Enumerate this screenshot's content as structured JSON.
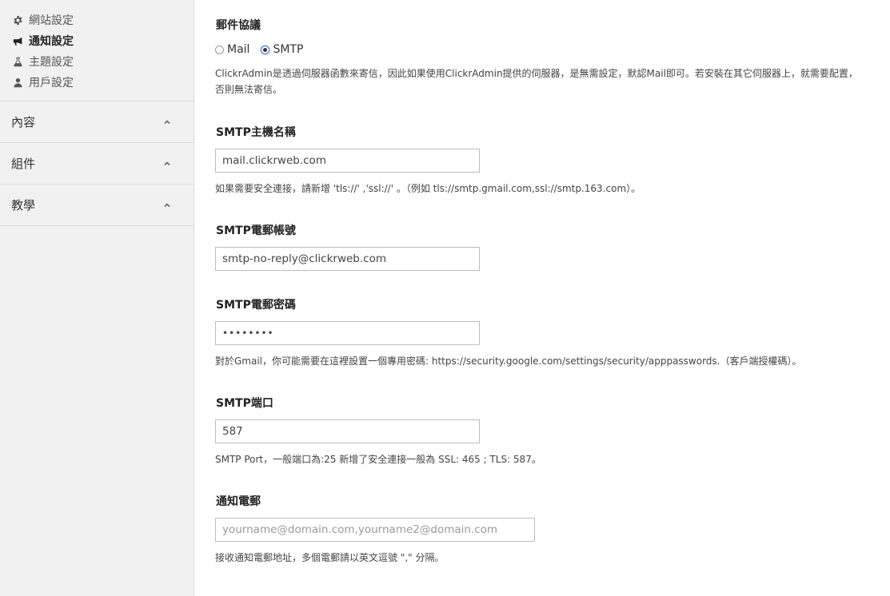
{
  "sidebar": {
    "sub_items": [
      {
        "label": "網站設定",
        "icon": "gear-icon",
        "active": false
      },
      {
        "label": "通知設定",
        "icon": "bullhorn-icon",
        "active": true
      },
      {
        "label": "主題設定",
        "icon": "flask-icon",
        "active": false
      },
      {
        "label": "用戶設定",
        "icon": "user-icon",
        "active": false
      }
    ],
    "sections": [
      {
        "label": "內容",
        "icon": "chevron-up-icon"
      },
      {
        "label": "組件",
        "icon": "chevron-up-icon"
      },
      {
        "label": "教學",
        "icon": "chevron-up-icon"
      }
    ]
  },
  "form": {
    "protocol": {
      "label": "郵件協議",
      "options": [
        "Mail",
        "SMTP"
      ],
      "selected": "SMTP",
      "help": "ClickrAdmin是透過伺服器函數來寄信，因此如果使用ClickrAdmin提供的伺服器，是無需設定，默認Mail即可。若安裝在其它伺服器上，就需要配置，否則無法寄信。"
    },
    "smtp_host": {
      "label": "SMTP主機名稱",
      "value": "mail.clickrweb.com",
      "help": "如果需要安全連接，請新增 'tls://' ,'ssl://' 。（例如 tls://smtp.gmail.com,ssl://smtp.163.com）。"
    },
    "smtp_user": {
      "label": "SMTP電郵帳號",
      "value": "smtp-no-reply@clickrweb.com"
    },
    "smtp_password": {
      "label": "SMTP電郵密碼",
      "value": "password",
      "help": "對於Gmail，你可能需要在這裡設置一個專用密碼: https://security.google.com/settings/security/apppasswords.（客戶端授權碼）。"
    },
    "smtp_port": {
      "label": "SMTP端口",
      "value": "587",
      "help": "SMTP Port，一般端口為:25 新增了安全連接一般為 SSL: 465 ; TLS: 587。"
    },
    "notify_email": {
      "label": "通知電郵",
      "value": "",
      "placeholder": "yourname@domain.com,yourname2@domain.com",
      "help": "接收通知電郵地址，多個電郵請以英文逗號 \",\" 分隔。"
    }
  }
}
